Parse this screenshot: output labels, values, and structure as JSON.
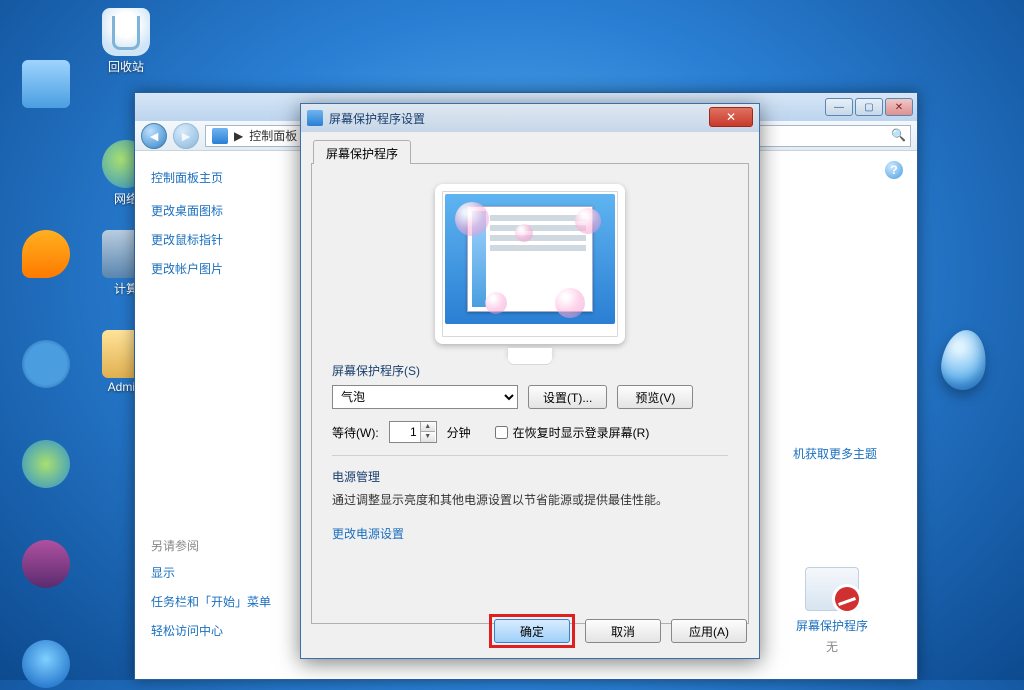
{
  "desktop": {
    "recycle": "回收站",
    "net": "网络",
    "computer": "计算",
    "admin": "Admini"
  },
  "cp": {
    "breadcrumb_sep": "▶",
    "breadcrumb_label": "控制面板",
    "sidebar": {
      "home": "控制面板主页",
      "links": [
        "更改桌面图标",
        "更改鼠标指针",
        "更改帐户图片"
      ],
      "seealso": "另请参阅",
      "also_links": [
        "显示",
        "任务栏和「开始」菜单",
        "轻松访问中心"
      ]
    },
    "getmore": "机获取更多主题",
    "ss_tile_label": "屏幕保护程序",
    "ss_tile_none": "无"
  },
  "dlg": {
    "title": "屏幕保护程序设置",
    "tab": "屏幕保护程序",
    "group_label": "屏幕保护程序(S)",
    "ss_selected": "气泡",
    "btn_settings": "设置(T)...",
    "btn_preview": "预览(V)",
    "wait_label": "等待(W):",
    "wait_value": "1",
    "wait_unit": "分钟",
    "chk_resume": "在恢复时显示登录屏幕(R)",
    "power_label": "电源管理",
    "power_desc": "通过调整显示亮度和其他电源设置以节省能源或提供最佳性能。",
    "power_link": "更改电源设置",
    "btn_ok": "确定",
    "btn_cancel": "取消",
    "btn_apply": "应用(A)"
  }
}
